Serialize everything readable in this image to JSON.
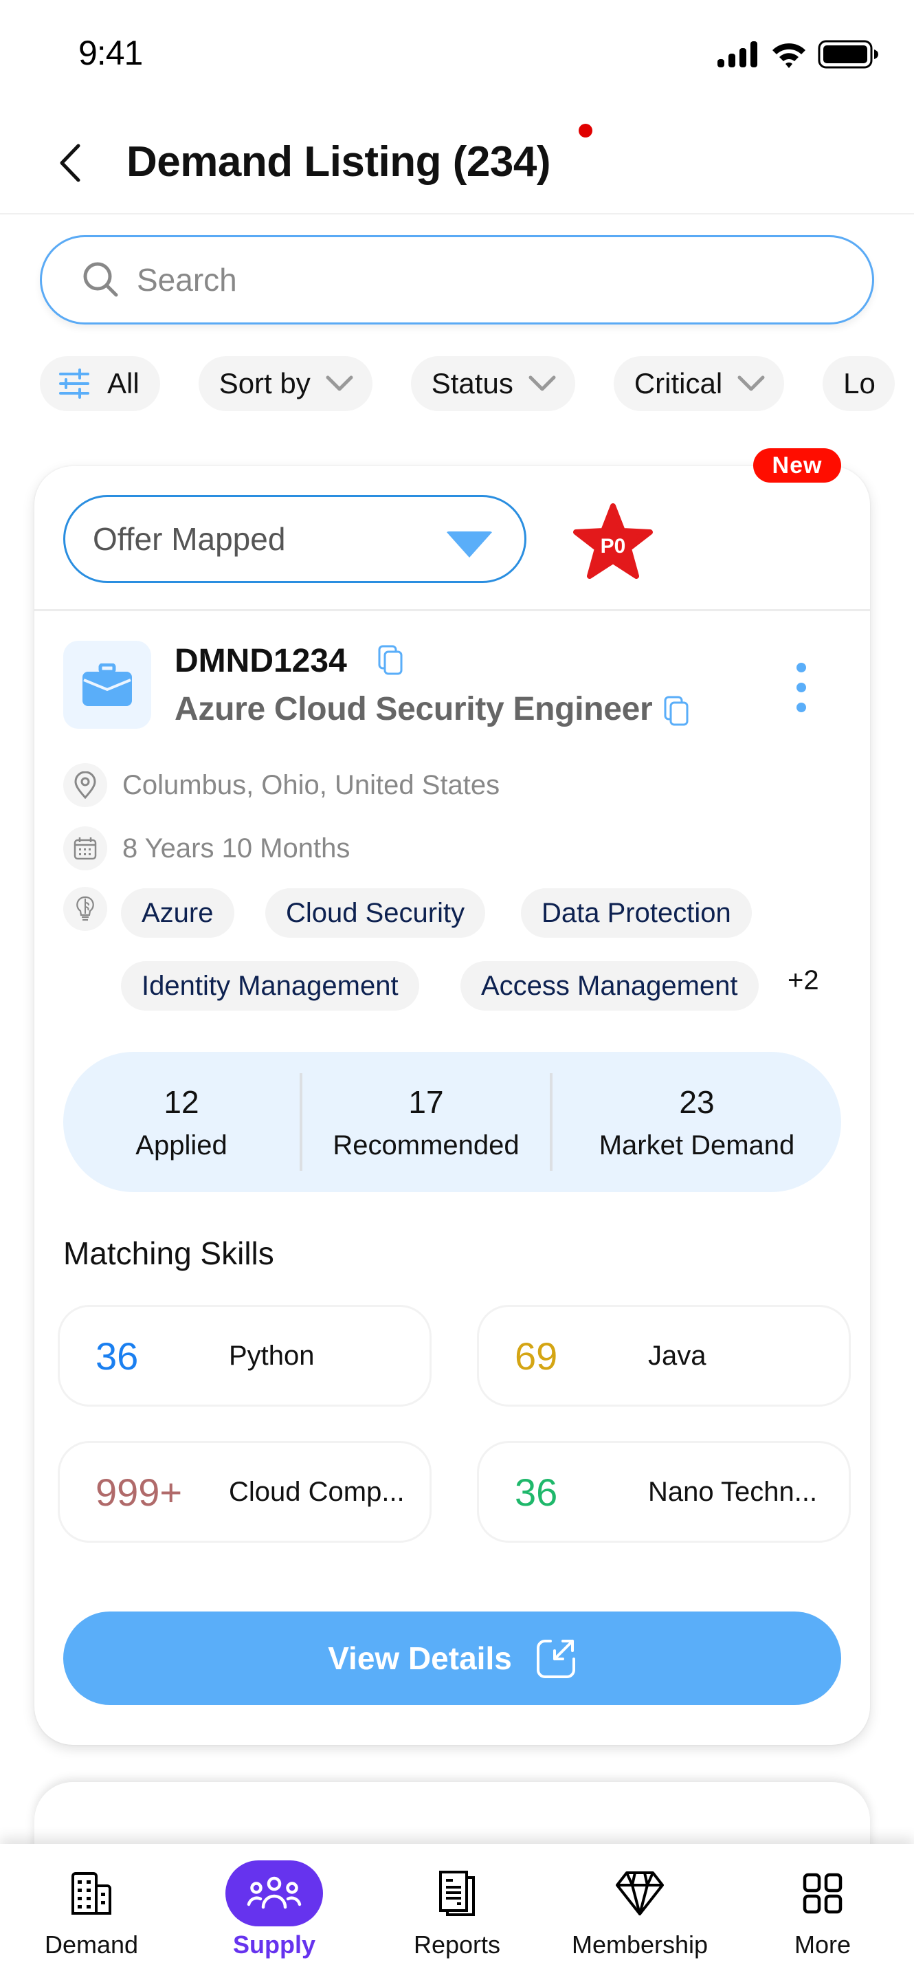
{
  "status_bar": {
    "time": "9:41",
    "icons": [
      "cellular-signal-icon",
      "wifi-icon",
      "battery-icon"
    ]
  },
  "header": {
    "back_icon": "chevron-left-icon",
    "title": "Demand Listing (234)",
    "notification_dot": true
  },
  "search": {
    "placeholder": "Search",
    "value": "",
    "icon": "search-icon"
  },
  "filters": [
    {
      "label": "All",
      "icon": "sliders-icon"
    },
    {
      "label": "Sort by",
      "icon": "chevron-down-icon"
    },
    {
      "label": "Status",
      "icon": "chevron-down-icon"
    },
    {
      "label": "Critical",
      "icon": "chevron-down-icon"
    },
    {
      "label": "Lo",
      "icon": ""
    }
  ],
  "demand_card": {
    "new_badge": "New",
    "status_select": "Offer Mapped",
    "priority": "P0",
    "demand_id": "DMND1234",
    "job_title": "Azure Cloud Security Engineer",
    "location": "Columbus, Ohio, United States",
    "experience": "8 Years 10 Months",
    "skills": [
      "Azure",
      "Cloud Security",
      "Data Protection",
      "Identity Management",
      "Access Management"
    ],
    "more_skills": "+2",
    "stats": [
      {
        "value": "12",
        "label": "Applied"
      },
      {
        "value": "17",
        "label": "Recommended"
      },
      {
        "value": "23",
        "label": "Market Demand"
      }
    ],
    "matching_title": "Matching Skills",
    "matching_skills": [
      {
        "count": "36",
        "name": "Python",
        "color": "#1a7ff0"
      },
      {
        "count": "69",
        "name": "Java",
        "color": "#d4a514"
      },
      {
        "count": "999+",
        "name": "Cloud Comp...",
        "color": "#b06a6a"
      },
      {
        "count": "36",
        "name": "Nano Techn...",
        "color": "#1fb86b"
      }
    ],
    "view_button": "View Details"
  },
  "bottom_nav": [
    {
      "label": "Demand",
      "icon": "building-icon",
      "active": false
    },
    {
      "label": "Supply",
      "icon": "people-group-icon",
      "active": true
    },
    {
      "label": "Reports",
      "icon": "document-icon",
      "active": false
    },
    {
      "label": "Membership",
      "icon": "diamond-icon",
      "active": false
    },
    {
      "label": "More",
      "icon": "grid-icon",
      "active": false
    }
  ],
  "colors": {
    "accent_blue": "#5aaef9",
    "border_blue": "#2a8ee0",
    "nav_active": "#6633ee",
    "badge_red": "#ff0d00",
    "priority_red": "#e3191b",
    "stats_bg": "#e8f3fe"
  }
}
